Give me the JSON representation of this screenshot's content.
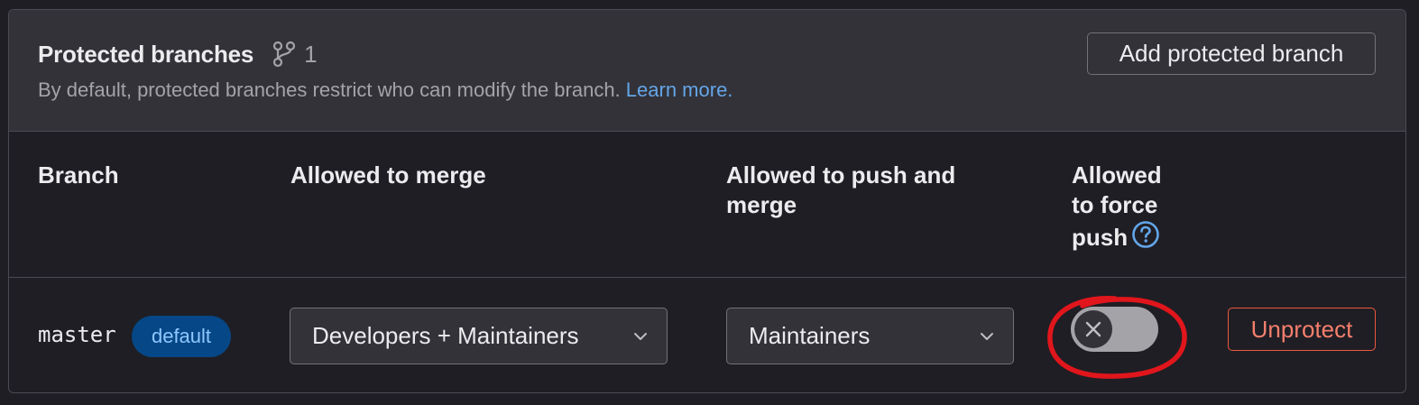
{
  "header": {
    "title": "Protected branches",
    "branch_count": "1",
    "description": "By default, protected branches restrict who can modify the branch.",
    "learn_more": "Learn more.",
    "add_button": "Add protected branch"
  },
  "table": {
    "columns": {
      "branch": "Branch",
      "allowed_to_merge": "Allowed to merge",
      "allowed_to_push_line1": "Allowed to push and",
      "allowed_to_push_line2": "merge",
      "force_push_line1": "Allowed",
      "force_push_line2": "to force",
      "force_push_line3": "push"
    },
    "rows": [
      {
        "branch": "master",
        "badge": "default",
        "allowed_to_merge": "Developers + Maintainers",
        "allowed_to_push": "Maintainers",
        "force_push_enabled": false,
        "unprotect_label": "Unprotect"
      }
    ]
  },
  "icons": {
    "branch": "branch-icon",
    "help": "question-circle-icon",
    "chevron": "chevron-down-icon",
    "close": "close-icon"
  },
  "colors": {
    "background": "#1f1e24",
    "header_bg": "#333238",
    "link": "#63a6e9",
    "badge_bg": "#064787",
    "badge_text": "#8fc7ff",
    "danger": "#ec5941",
    "annotation": "#e0161c"
  }
}
